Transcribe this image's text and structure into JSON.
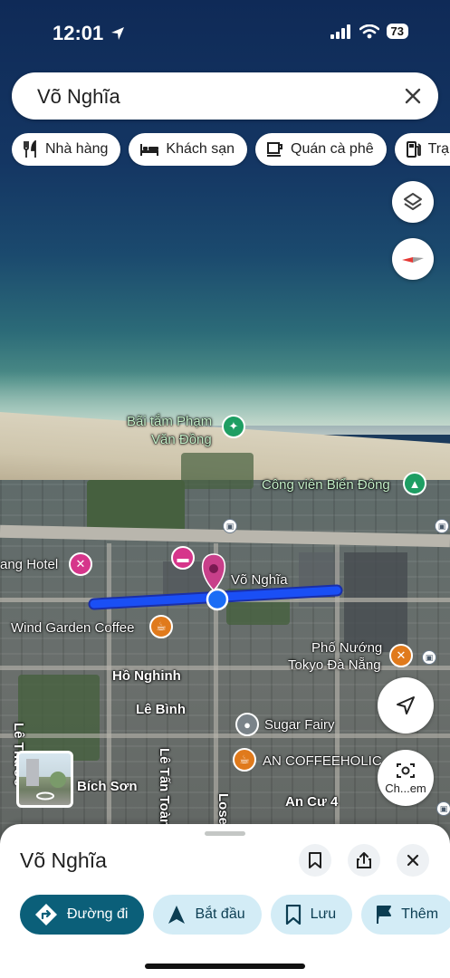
{
  "status": {
    "time": "12:01",
    "battery": "73"
  },
  "search": {
    "query": "Võ Nghĩa"
  },
  "chips": [
    {
      "label": "Nhà hàng",
      "icon": "fork-knife-icon"
    },
    {
      "label": "Khách sạn",
      "icon": "bed-icon"
    },
    {
      "label": "Quán cà phê",
      "icon": "coffee-cup-icon"
    },
    {
      "label": "Trạm",
      "icon": "gas-pump-icon"
    }
  ],
  "map": {
    "labels": {
      "beach1": "Bãi tắm Phạm",
      "beach2": "Văn Đồng",
      "park": "Công viên Biển Đông",
      "hotel": "ang Hotel",
      "street": "Võ Nghĩa",
      "wind": "Wind Garden Coffee",
      "grill1": "Phố Nướng",
      "grill2": "Tokyo Đà Nẵng",
      "honghinh": "Hồ Nghinh",
      "lebinh": "Lê Bình",
      "sugar": "Sugar Fairy",
      "anco": "AN COFFEEHOLIC",
      "lethuoc": "Lê Thước",
      "lettoan": "Lê Tấn Toàn",
      "lose": "Lose",
      "bichson": "Bích Sơn",
      "ancu": "An Cư 4"
    },
    "chevron_label": "Ch...em"
  },
  "sheet": {
    "title": "Võ Nghĩa",
    "actions": [
      {
        "label": "Đường đi",
        "icon": "directions-icon"
      },
      {
        "label": "Bắt đầu",
        "icon": "navigation-arrow-icon"
      },
      {
        "label": "Lưu",
        "icon": "bookmark-icon"
      },
      {
        "label": "Thêm",
        "icon": "flag-icon"
      }
    ]
  },
  "colors": {
    "accent": "#0b5f79",
    "route": "#1a4ff5",
    "chip_bg": "#ffffff"
  }
}
